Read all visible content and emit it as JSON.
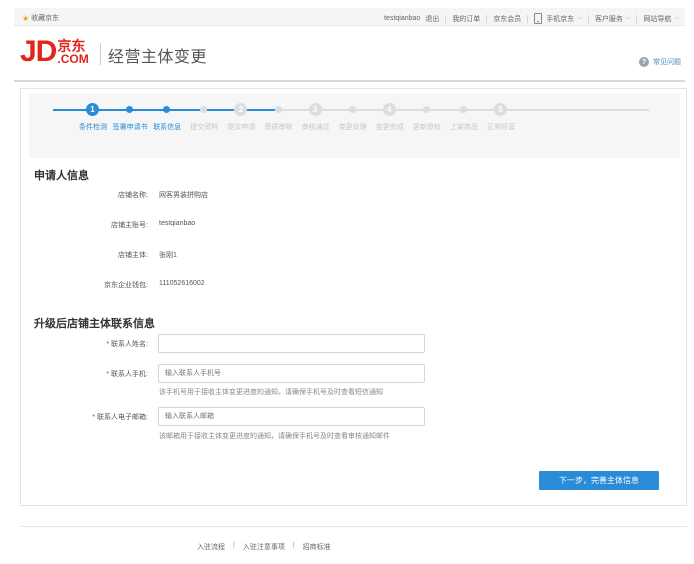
{
  "topbar": {
    "favorite": "收藏京东",
    "username": "testqianbao",
    "logout": "退出",
    "my_orders": "我的订单",
    "jd_member": "京东会员",
    "mobile_jd": "手机京东",
    "customer_service": "客户服务",
    "site_nav": "网站导航"
  },
  "header": {
    "logo_jd": "JD",
    "logo_cn": "京东",
    "logo_com": ".COM",
    "title": "经营主体变更",
    "faq": "常见问题"
  },
  "steps": [
    {
      "label": "条件检测",
      "num": "1",
      "active": true
    },
    {
      "label": "签署申请书",
      "num": "",
      "active": true
    },
    {
      "label": "联系信息",
      "num": "",
      "active": true
    },
    {
      "label": "提交资料",
      "num": "",
      "active": false
    },
    {
      "label": "提交申请",
      "num": "2",
      "active": false
    },
    {
      "label": "资质审核",
      "num": "",
      "active": false
    },
    {
      "label": "审核通过",
      "num": "3",
      "active": false
    },
    {
      "label": "变更处理",
      "num": "",
      "active": false
    },
    {
      "label": "变更完成",
      "num": "4",
      "active": false
    },
    {
      "label": "更新授权",
      "num": "",
      "active": false
    },
    {
      "label": "上架商品",
      "num": "",
      "active": false
    },
    {
      "label": "正常经营",
      "num": "5",
      "active": false
    }
  ],
  "applicant": {
    "title": "申请人信息",
    "shop_name_label": "店铺名称:",
    "shop_name": "网客男装拼购店",
    "account_label": "店铺主账号:",
    "account": "testqianbao",
    "entity_label": "店铺主体:",
    "entity": "张刚1",
    "wallet_label": "京东企业钱包:",
    "wallet": "111052616002"
  },
  "contact": {
    "title": "升级后店铺主体联系信息",
    "name_label": "联系人姓名:",
    "name_value": "",
    "phone_label": "联系人手机:",
    "phone_placeholder": "输入联系人手机号",
    "phone_hint": "该手机号用于接收主体变更进度的通知，请确保手机号及时查看短信通知",
    "email_label": "联系人电子邮箱:",
    "email_placeholder": "输入联系人邮箱",
    "email_hint": "该邮箱用于接收主体变更进度的通知，请确保手机号及时查看审核通知邮件"
  },
  "next_button": "下一步，完善主体信息",
  "footer": {
    "links": [
      "入驻流程",
      "入驻注意事项",
      "招商标准"
    ]
  },
  "colors": {
    "brand_red": "#e1251b",
    "accent_blue": "#2a8bd6"
  }
}
